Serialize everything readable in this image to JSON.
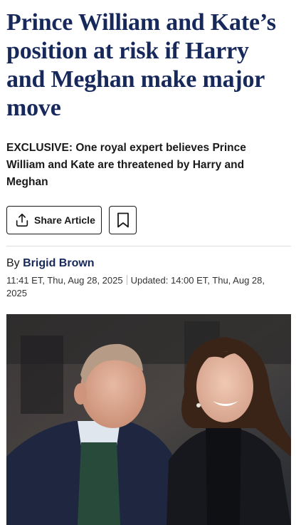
{
  "article": {
    "headline": "Prince William and Kate’s position at risk if Harry and Meghan make major move",
    "standfirst": "EXCLUSIVE: One royal expert believes Prince William and Kate are threatened by Harry and Meghan",
    "share_label": "Share Article",
    "byline_prefix": "By",
    "author": "Brigid Brown",
    "published": "11:41 ET, Thu, Aug 28, 2025",
    "updated": "Updated: 14:00 ET, Thu, Aug 28, 2025"
  },
  "icons": {
    "share": "share-icon",
    "bookmark": "bookmark-icon"
  },
  "colors": {
    "headline": "#17285b",
    "author": "#17285b",
    "text": "#1a1a1a"
  }
}
